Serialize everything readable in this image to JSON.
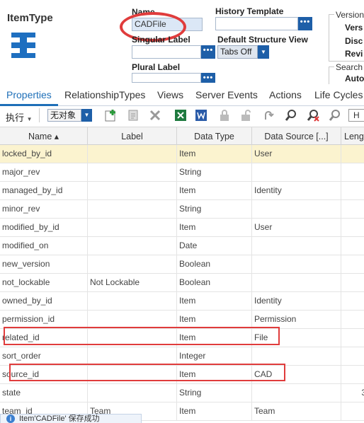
{
  "header": {
    "title": "ItemType",
    "name_label": "Name",
    "name_value": "CADFile",
    "singular_label": "Singular Label",
    "singular_value": "",
    "plural_label": "Plural Label",
    "plural_value": "",
    "history_label": "History Template",
    "history_value": "",
    "default_view_label": "Default Structure View",
    "default_view_value": "Tabs Off",
    "ellipsis": "•••",
    "version_group": {
      "title": "Version",
      "items": [
        "Vers",
        "Disc",
        "Revi"
      ]
    },
    "search_group": {
      "title": "Search",
      "items": [
        "Auto"
      ]
    },
    "colors": {
      "accent": "#1e6fb8",
      "button": "#1e5fa8",
      "highlight": "#e03c3c",
      "selected_row": "#fbf3cf"
    }
  },
  "tabs": [
    {
      "label": "Properties",
      "active": true
    },
    {
      "label": "RelationshipTypes"
    },
    {
      "label": "Views"
    },
    {
      "label": "Server Events"
    },
    {
      "label": "Actions"
    },
    {
      "label": "Life Cycles"
    }
  ],
  "toolbar": {
    "exec_label": "执行",
    "exec_arrow": "▼",
    "select_value": "无对象",
    "select_arrow": "▼",
    "right_box": "H",
    "icons": [
      "add-icon",
      "search-item-icon",
      "delete-icon",
      "excel-icon",
      "word-icon",
      "lock-icon",
      "unlock-icon",
      "redo-icon",
      "find-icon",
      "clear-search-icon",
      "search-settings-icon"
    ]
  },
  "grid": {
    "columns": [
      "Name ▴",
      "Label",
      "Data Type",
      "Data Source [...]",
      "Lengt"
    ],
    "rows": [
      {
        "name": "locked_by_id",
        "label": "",
        "type": "Item",
        "source": "User",
        "length": "",
        "selected": true
      },
      {
        "name": "major_rev",
        "label": "",
        "type": "String",
        "source": "",
        "length": ""
      },
      {
        "name": "managed_by_id",
        "label": "",
        "type": "Item",
        "source": "Identity",
        "length": ""
      },
      {
        "name": "minor_rev",
        "label": "",
        "type": "String",
        "source": "",
        "length": ""
      },
      {
        "name": "modified_by_id",
        "label": "",
        "type": "Item",
        "source": "User",
        "length": ""
      },
      {
        "name": "modified_on",
        "label": "",
        "type": "Date",
        "source": "",
        "length": ""
      },
      {
        "name": "new_version",
        "label": "",
        "type": "Boolean",
        "source": "",
        "length": ""
      },
      {
        "name": "not_lockable",
        "label": "Not Lockable",
        "type": "Boolean",
        "source": "",
        "length": ""
      },
      {
        "name": "owned_by_id",
        "label": "",
        "type": "Item",
        "source": "Identity",
        "length": ""
      },
      {
        "name": "permission_id",
        "label": "",
        "type": "Item",
        "source": "Permission",
        "length": ""
      },
      {
        "name": "related_id",
        "label": "",
        "type": "Item",
        "source": "File",
        "length": "",
        "highlight": true
      },
      {
        "name": "sort_order",
        "label": "",
        "type": "Integer",
        "source": "",
        "length": ""
      },
      {
        "name": "source_id",
        "label": "",
        "type": "Item",
        "source": "CAD",
        "length": "",
        "highlight": true
      },
      {
        "name": "state",
        "label": "",
        "type": "String",
        "source": "",
        "length": "3"
      },
      {
        "name": "team_id",
        "label": "Team",
        "type": "Item",
        "source": "Team",
        "length": ""
      }
    ]
  },
  "status_toast": {
    "text": "Item'CADFile' 保存成功"
  }
}
